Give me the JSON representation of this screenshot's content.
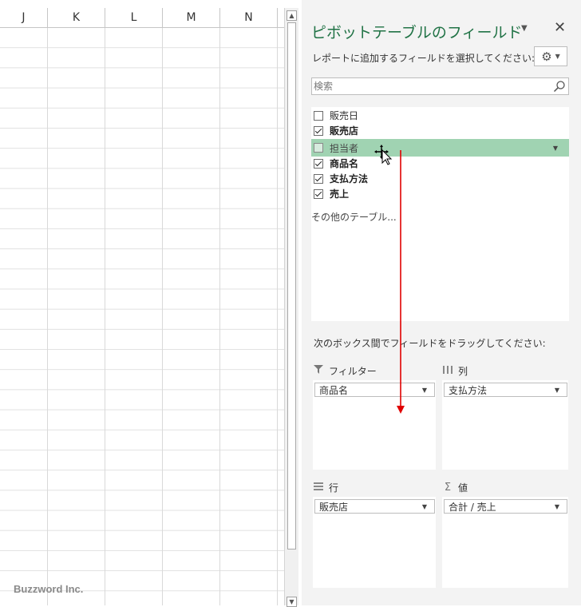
{
  "sheet": {
    "columns": [
      "J",
      "K",
      "L",
      "M",
      "N"
    ],
    "watermark": "Buzzword Inc."
  },
  "pane": {
    "title": "ピボットテーブルのフィールド",
    "instruction": "レポートに追加するフィールドを選択してください:",
    "search_placeholder": "検索",
    "fields": [
      {
        "label": "販売日",
        "checked": false,
        "bold": false,
        "highlight": false
      },
      {
        "label": "販売店",
        "checked": true,
        "bold": true,
        "highlight": false
      },
      {
        "label": "担当者",
        "checked": false,
        "bold": false,
        "highlight": true
      },
      {
        "label": "商品名",
        "checked": true,
        "bold": true,
        "highlight": false
      },
      {
        "label": "支払方法",
        "checked": true,
        "bold": true,
        "highlight": false
      },
      {
        "label": "売上",
        "checked": true,
        "bold": true,
        "highlight": false
      }
    ],
    "other_tables": "その他のテーブル...",
    "drag_hint": "次のボックス間でフィールドをドラッグしてください:",
    "areas": {
      "filter": {
        "label": "フィルター",
        "item": "商品名"
      },
      "columns": {
        "label": "列",
        "item": "支払方法"
      },
      "rows": {
        "label": "行",
        "item": "販売店"
      },
      "values": {
        "label": "値",
        "item": "合計 / 売上"
      }
    }
  },
  "icons": {
    "filter": "filter-icon",
    "columns": "columns-icon",
    "rows": "rows-icon",
    "values": "sigma-icon",
    "gear": "gear-icon",
    "close": "close-icon",
    "search": "search-icon"
  },
  "colors": {
    "title": "#217346",
    "highlight": "#a0d3b2",
    "drag_arrow": "#e00000"
  }
}
